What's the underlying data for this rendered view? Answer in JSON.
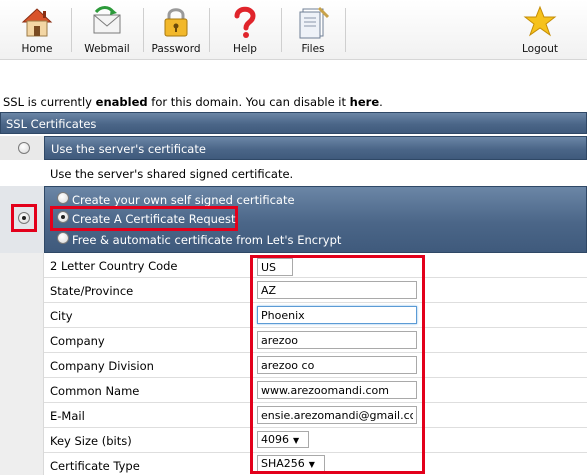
{
  "toolbar": {
    "items": [
      {
        "label": "Home",
        "icon": "home-icon"
      },
      {
        "label": "Webmail",
        "icon": "webmail-icon"
      },
      {
        "label": "Password",
        "icon": "padlock-icon"
      },
      {
        "label": "Help",
        "icon": "help-icon"
      },
      {
        "label": "Files",
        "icon": "files-icon"
      },
      {
        "label": "Logout",
        "icon": "star-icon"
      }
    ]
  },
  "status": {
    "prefix": "SSL is currently ",
    "state": "enabled",
    "middle": " for this domain. You can disable it ",
    "link": "here",
    "suffix": "."
  },
  "ssl_section": {
    "title": "SSL Certificates",
    "server_cert_option": "Use the server's certificate",
    "server_cert_desc": "Use the server's shared signed certificate.",
    "options": [
      "Create your own self signed certificate",
      "Create A Certificate Request",
      "Free & automatic certificate from Let's Encrypt"
    ],
    "selected_option": "Create A Certificate Request"
  },
  "form": {
    "country_label": "2 Letter Country Code",
    "country_value": "US",
    "state_label": "State/Province",
    "state_value": "AZ",
    "city_label": "City",
    "city_value": "Phoenix",
    "company_label": "Company",
    "company_value": "arezoo",
    "division_label": "Company Division",
    "division_value": "arezoo co",
    "common_name_label": "Common Name",
    "common_name_value": "www.arezoomandi.com",
    "email_label": "E-Mail",
    "email_value": "ensie.arezomandi@gmail.cc",
    "key_size_label": "Key Size (bits)",
    "key_size_value": "4096",
    "cert_type_label": "Certificate Type",
    "cert_type_value": "SHA256"
  },
  "colors": {
    "header_bar": "#4b6688",
    "highlight_border": "#e3001b",
    "gutter": "#eeeeee"
  }
}
